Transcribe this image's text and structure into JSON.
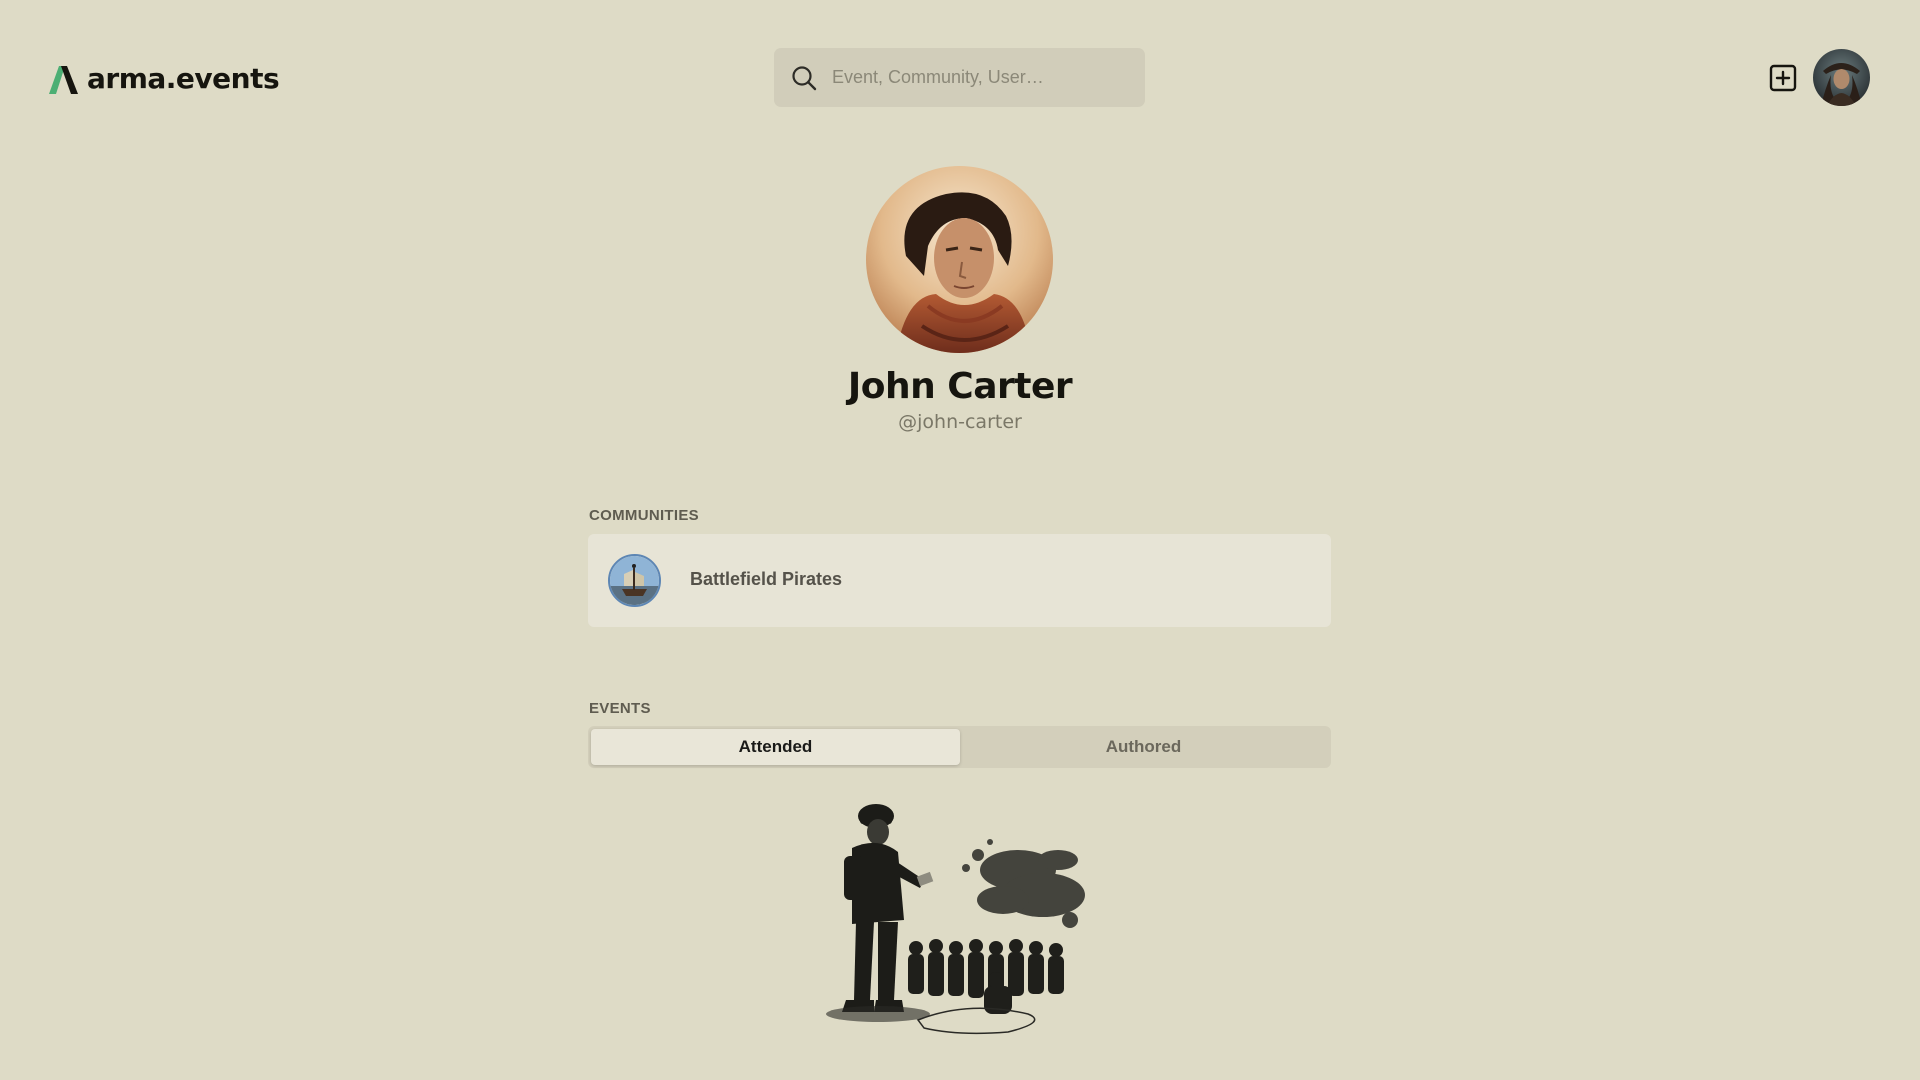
{
  "header": {
    "site_name": "arma.events",
    "search_placeholder": "Event, Community, User…",
    "icons": {
      "logo": "arma-logo-icon",
      "search": "search-icon",
      "add": "plus-square-icon"
    }
  },
  "profile": {
    "name": "John Carter",
    "handle": "@john-carter"
  },
  "communities": {
    "label": "COMMUNITIES",
    "items": [
      {
        "name": "Battlefield Pirates"
      }
    ]
  },
  "events": {
    "label": "EVENTS",
    "tabs": [
      {
        "label": "Attended",
        "active": true
      },
      {
        "label": "Authored",
        "active": false
      }
    ]
  },
  "colors": {
    "background": "#dedbc6",
    "search_bg": "#d1cdba",
    "card_bg": "#e7e4d6",
    "logo_green": "#4caf74"
  }
}
